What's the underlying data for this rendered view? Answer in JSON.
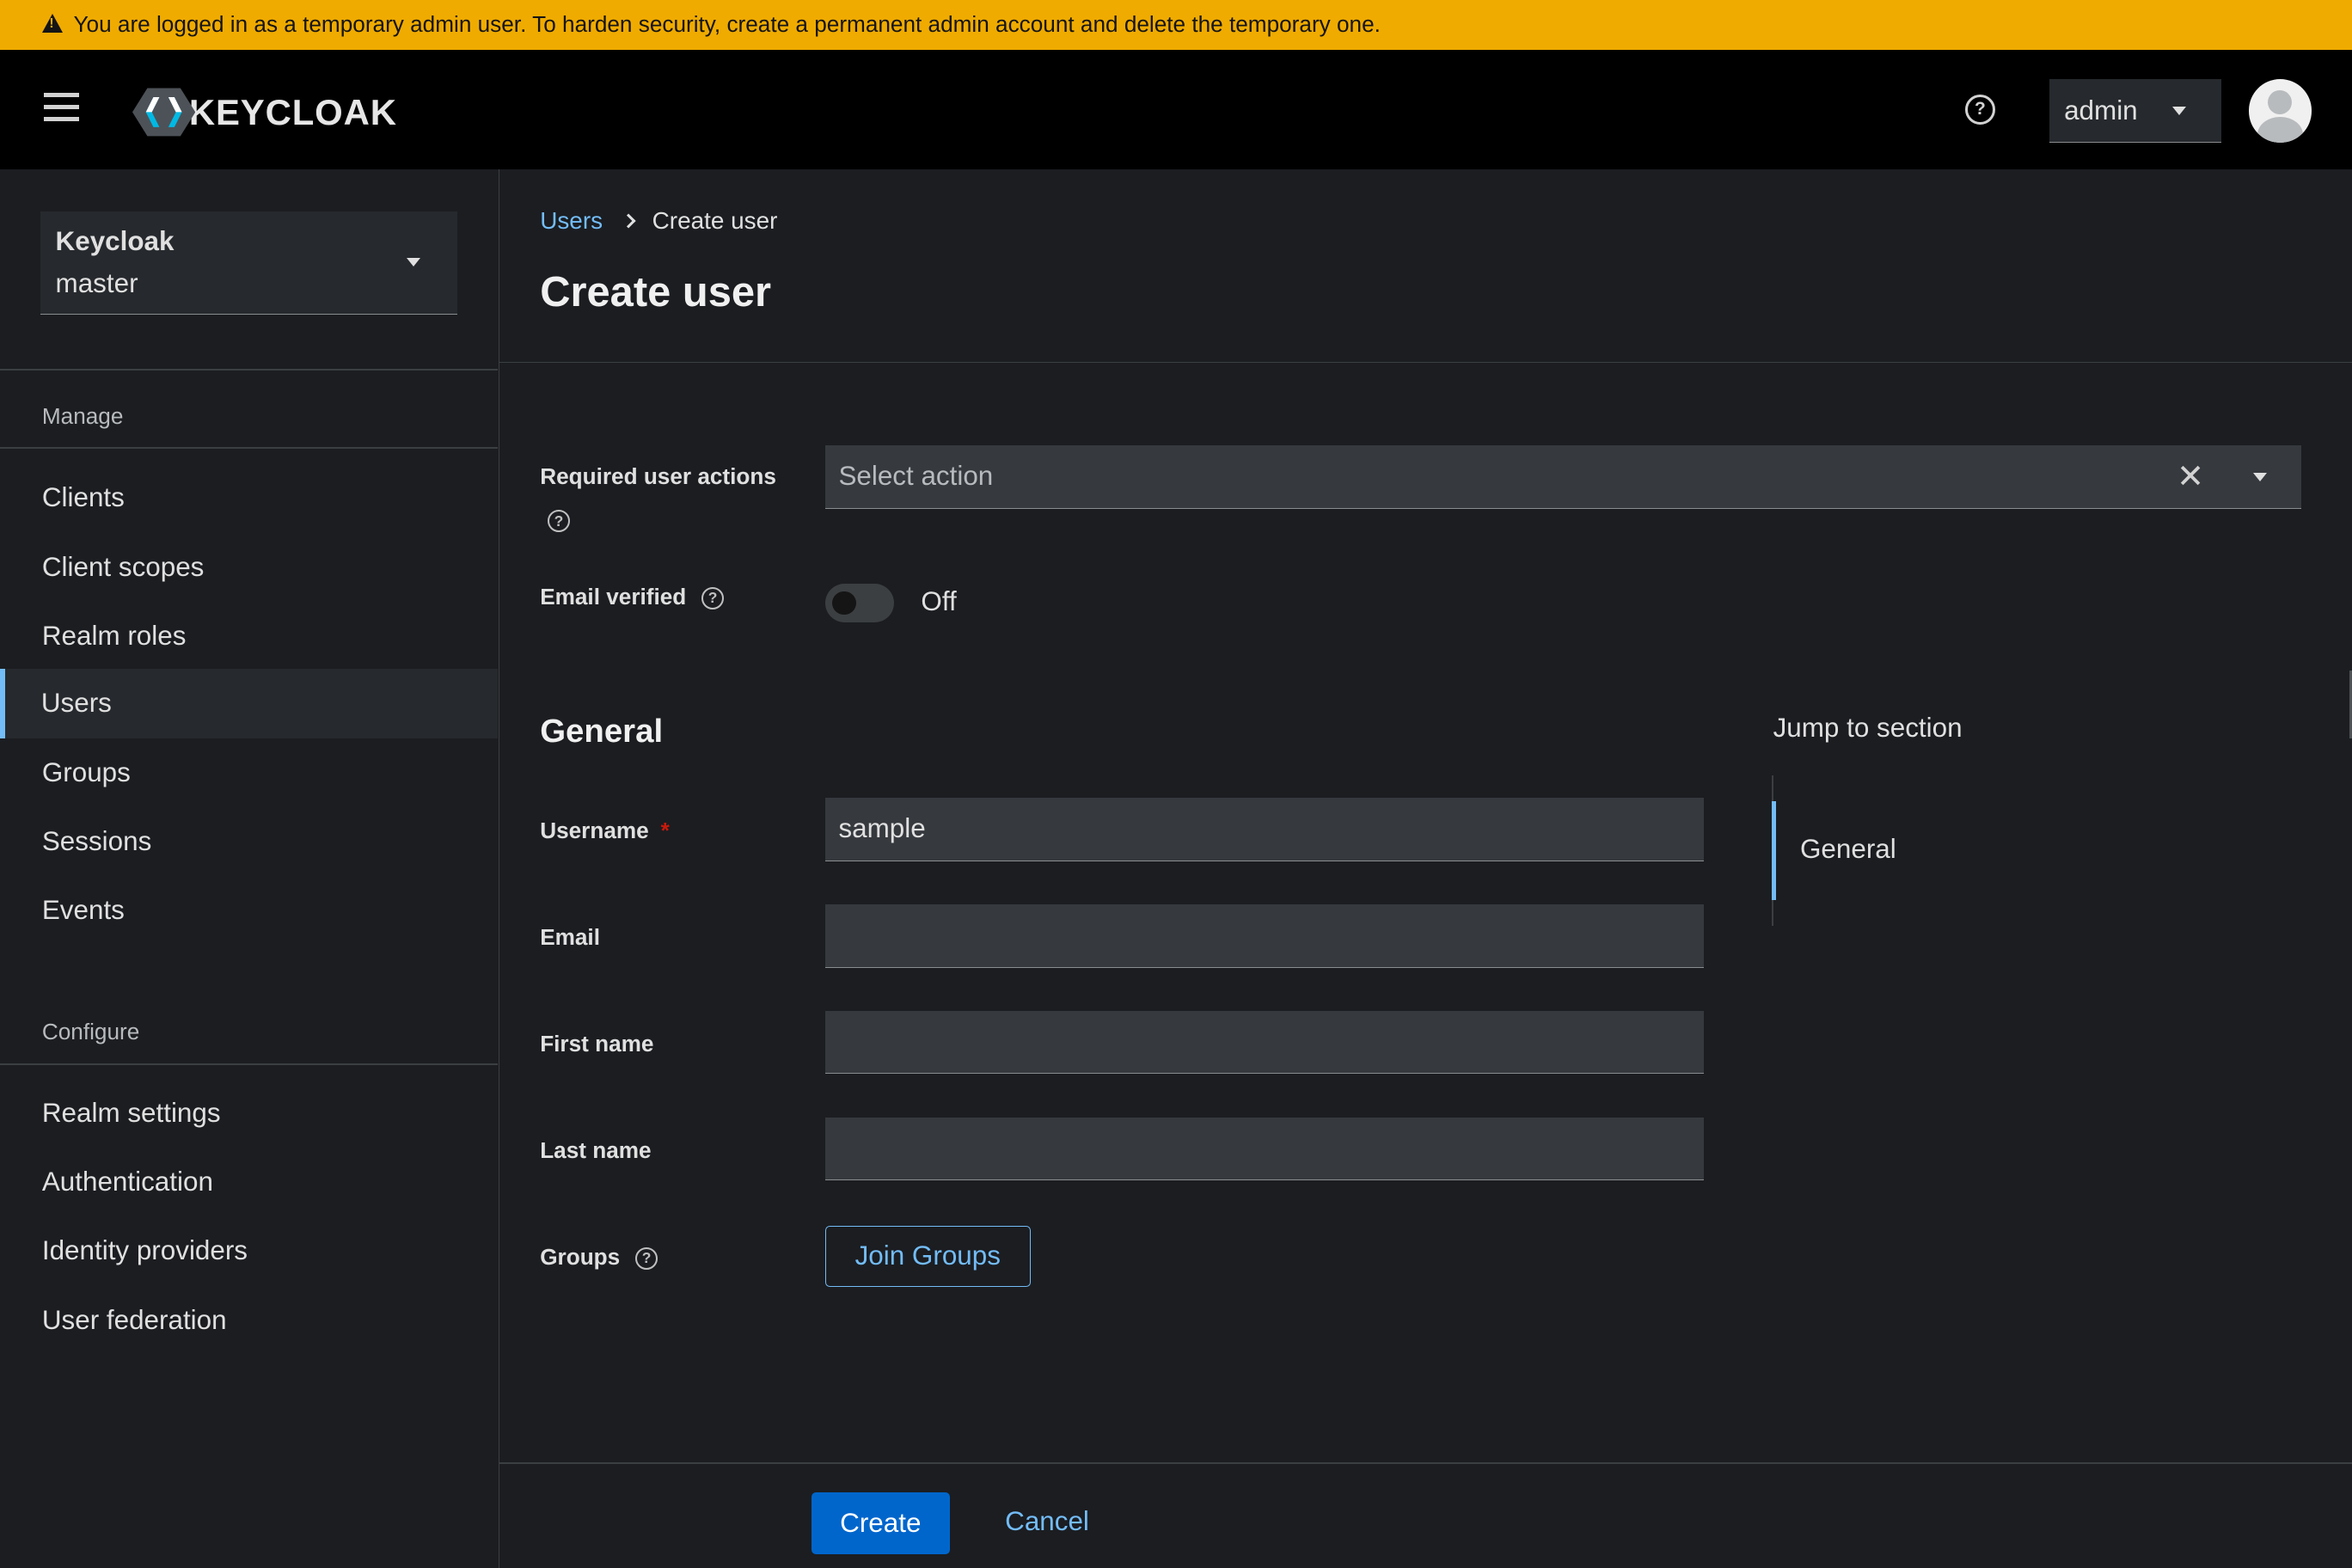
{
  "banner": {
    "text": "You are logged in as a temporary admin user. To harden security, create a permanent admin account and delete the temporary one.",
    "icon": "warning-icon",
    "color": "#f0ab00"
  },
  "masthead": {
    "brand": "KEYCLOAK",
    "user": "admin"
  },
  "sidebar": {
    "realm_name": "Keycloak",
    "realm_sub": "master",
    "manage_label": "Manage",
    "configure_label": "Configure",
    "manage_items": [
      "Clients",
      "Client scopes",
      "Realm roles",
      "Users",
      "Groups",
      "Sessions",
      "Events"
    ],
    "configure_items": [
      "Realm settings",
      "Authentication",
      "Identity providers",
      "User federation"
    ],
    "active": "Users"
  },
  "main": {
    "breadcrumb_link": "Users",
    "breadcrumb_current": "Create user",
    "title": "Create user",
    "required_actions_label": "Required user actions",
    "required_actions_placeholder": "Select action",
    "email_verified_label": "Email verified",
    "email_verified_state": "Off",
    "section_title": "General",
    "username_label": "Username",
    "username_value": "sample",
    "email_label": "Email",
    "email_value": "",
    "first_name_label": "First name",
    "first_name_value": "",
    "last_name_label": "Last name",
    "last_name_value": "",
    "groups_label": "Groups",
    "join_groups": "Join Groups",
    "jump_title": "Jump to section",
    "jump_item": "General",
    "create": "Create",
    "cancel": "Cancel"
  },
  "colors": {
    "accent": "#73bcf7",
    "primary": "#0066cc",
    "background": "#1b1d21"
  }
}
